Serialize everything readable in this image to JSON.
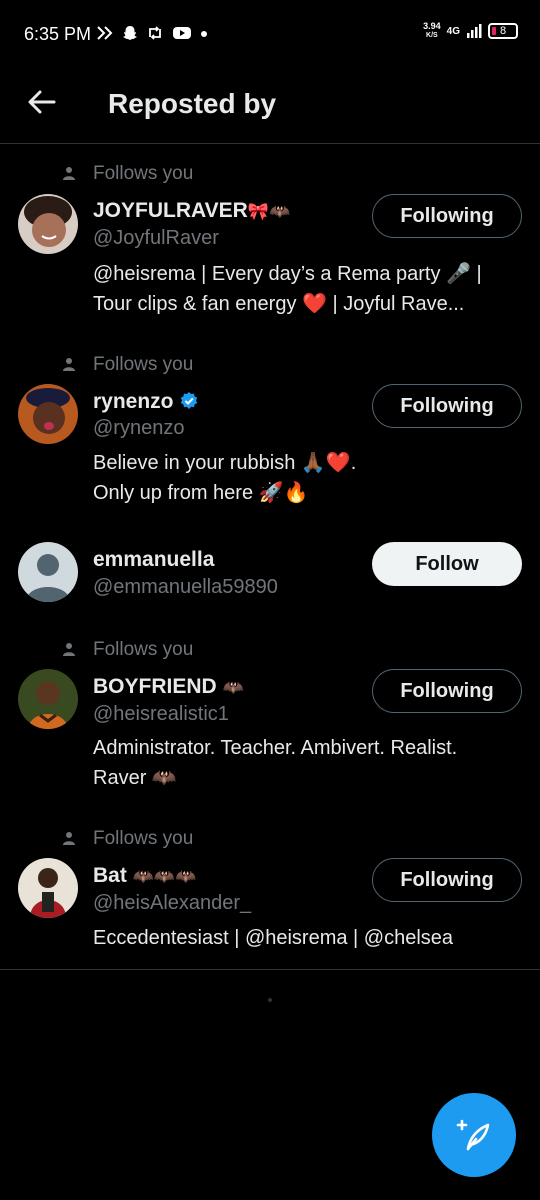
{
  "status": {
    "time": "6:35 PM",
    "speed_top": "3.94",
    "speed_bottom": "K/S",
    "network": "4G",
    "battery": "8"
  },
  "header": {
    "title": "Reposted by"
  },
  "users": [
    {
      "follows_you": "Follows you",
      "name": "JOYFULRAVER",
      "name_emoji": "🎀🦇",
      "handle": "@JoyfulRaver",
      "bio": "@heisrema | Every day’s a Rema party 🎤 | Tour clips & fan energy ❤️ | Joyful Rave...",
      "button": "Following"
    },
    {
      "follows_you": "Follows you",
      "name": "rynenzo",
      "handle": "@rynenzo",
      "bio_line1": "Believe in your rubbish 🙏🏾❤️.",
      "bio_line2": "Only up from here 🚀🔥",
      "button": "Following"
    },
    {
      "name": "emmanuella",
      "handle": "@emmanuella59890",
      "button": "Follow"
    },
    {
      "follows_you": "Follows you",
      "name": "BOYFRIEND",
      "name_emoji": "🦇",
      "handle": "@heisrealistic1",
      "bio_line1": "Administrator. Teacher. Ambivert. Realist.",
      "bio_line2": "Raver 🦇",
      "button": "Following"
    },
    {
      "follows_you": "Follows you",
      "name": "Bat",
      "name_emoji": "🦇🦇🦇",
      "handle": "@heisAlexander_",
      "bio": "Eccedentesiast | @heisrema | @chelsea",
      "button": "Following"
    }
  ],
  "colors": {
    "accent": "#1d9bf0",
    "background": "#000000",
    "secondary_text": "#71767b",
    "verified": "#1d9bf0"
  }
}
